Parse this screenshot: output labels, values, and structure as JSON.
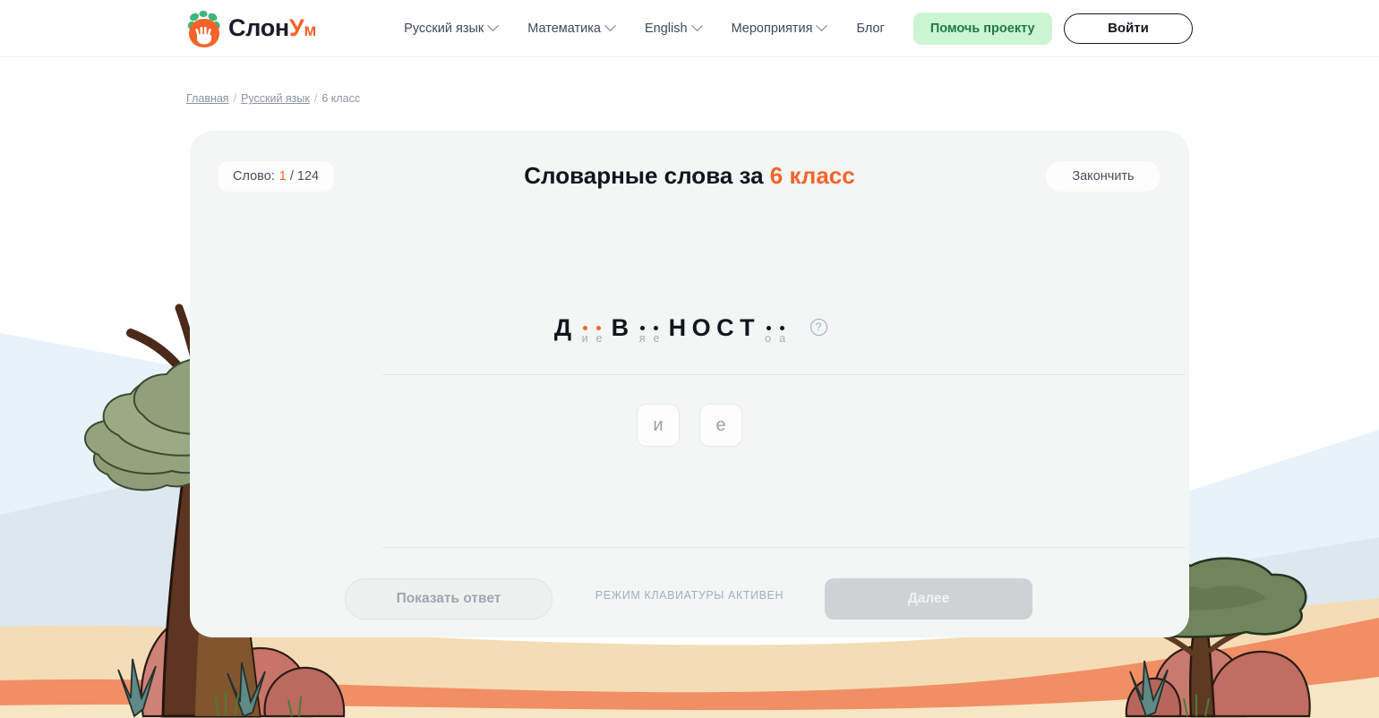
{
  "header": {
    "logo": {
      "icon": "elephant-paw-logo-icon",
      "text_main": "Слон",
      "text_accent_u": "У",
      "text_accent_m": "м"
    },
    "nav": [
      {
        "label": "Русский язык",
        "has_caret": true
      },
      {
        "label": "Математика",
        "has_caret": true
      },
      {
        "label": "English",
        "has_caret": true
      },
      {
        "label": "Мероприятия",
        "has_caret": true
      },
      {
        "label": "Блог",
        "has_caret": false
      }
    ],
    "help_button": "Помочь проекту",
    "login_button": "Войти"
  },
  "breadcrumb": {
    "home": "Главная",
    "sep1": "/",
    "subject": "Русский язык",
    "sep2": "/",
    "current": "6 класс"
  },
  "card": {
    "counter": {
      "label": "Слово:",
      "current": "1",
      "separator_total": "/ 124"
    },
    "title_main": "Словарные слова за",
    "title_grade": "6 класс",
    "finish_button": "Закончить",
    "help_icon_glyph": "?",
    "puzzle": {
      "word_parts": [
        {
          "type": "letter",
          "text": "Д"
        },
        {
          "type": "gap",
          "accent": true,
          "hints": [
            "и",
            "е"
          ]
        },
        {
          "type": "letter",
          "text": "В"
        },
        {
          "type": "gap",
          "accent": false,
          "hints": [
            "я",
            "е"
          ]
        },
        {
          "type": "letter",
          "text": "Н"
        },
        {
          "type": "letter",
          "text": "О"
        },
        {
          "type": "letter",
          "text": "С"
        },
        {
          "type": "letter",
          "text": "Т"
        },
        {
          "type": "gap",
          "accent": false,
          "hints": [
            "о",
            "а"
          ]
        }
      ],
      "choices": [
        "и",
        "е"
      ]
    }
  },
  "controls": {
    "show_answer": "Показать ответ",
    "keyboard_status": "РЕЖИМ КЛАВИАТУРЫ АКТИВЕН",
    "next": "Далее"
  },
  "colors": {
    "accent_orange": "#f4642a",
    "help_green_bg": "#ccf5d3",
    "help_green_text": "#1f7a44",
    "card_bg": "#f2f6f4",
    "text_dark": "#14141e",
    "muted": "#a8aeb9"
  }
}
